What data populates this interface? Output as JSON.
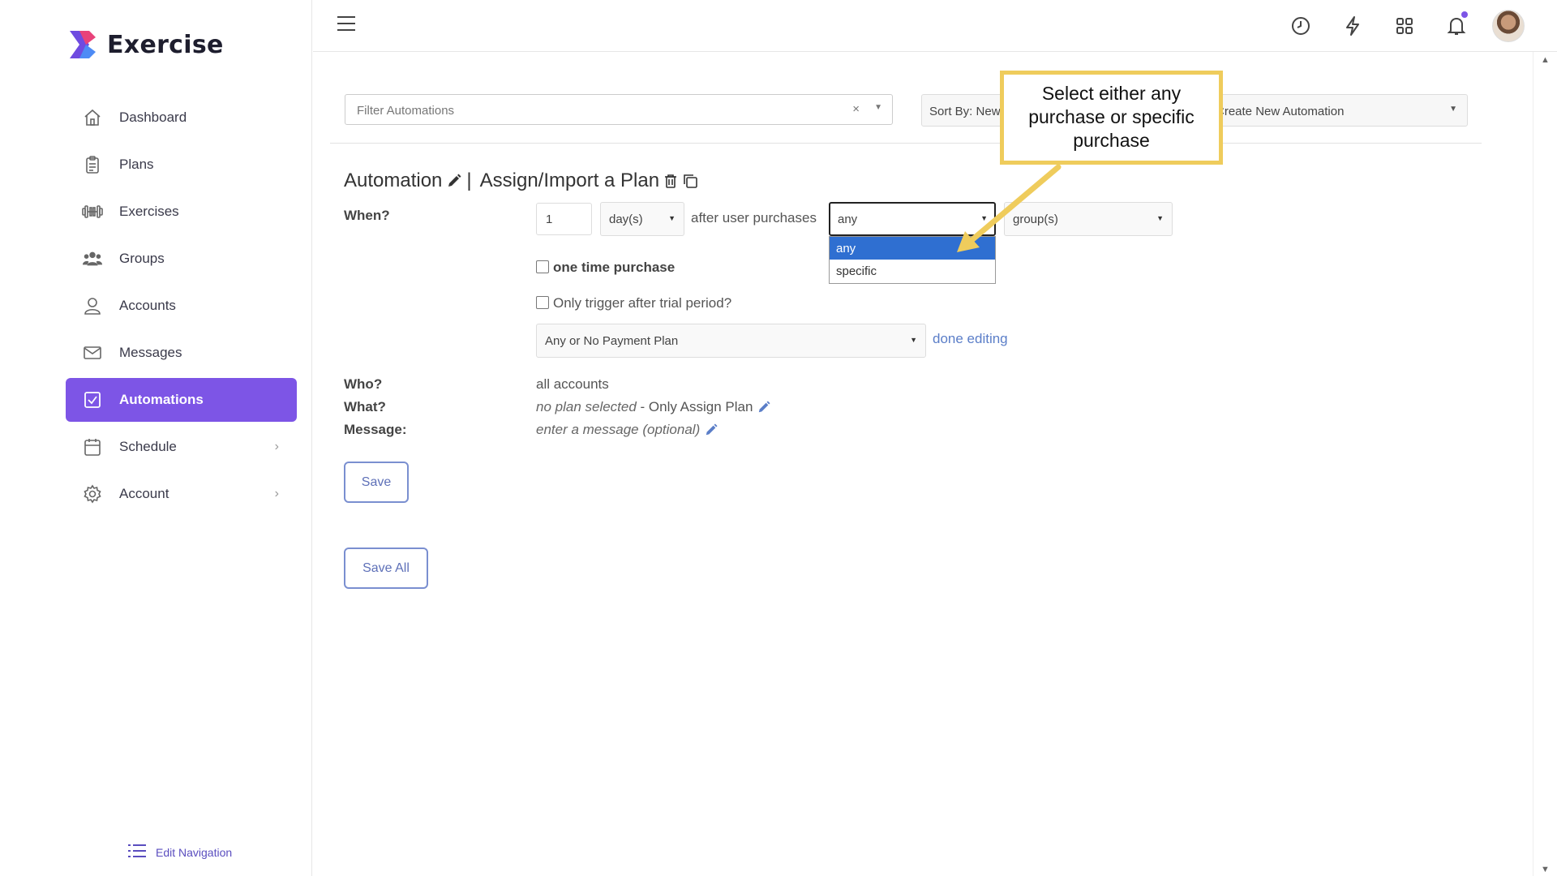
{
  "app": {
    "name": "Exercise"
  },
  "sidebar": {
    "items": [
      {
        "label": "Dashboard"
      },
      {
        "label": "Plans"
      },
      {
        "label": "Exercises"
      },
      {
        "label": "Groups"
      },
      {
        "label": "Accounts"
      },
      {
        "label": "Messages"
      },
      {
        "label": "Automations",
        "active": true
      },
      {
        "label": "Schedule",
        "has_submenu": true
      },
      {
        "label": "Account",
        "has_submenu": true
      }
    ],
    "edit_nav": "Edit Navigation"
  },
  "toolbar": {
    "filter_placeholder": "Filter Automations",
    "clear_glyph": "×",
    "sort_label": "Sort By: Newest",
    "create_label": "Create New Automation"
  },
  "callout": {
    "text": "Select either any\npurchase or specific\npurchase"
  },
  "automation": {
    "title_prefix": "Automation",
    "separator": "|",
    "title_name": "Assign/Import a Plan",
    "when_label": "When?",
    "when_number": "1",
    "unit": "day(s)",
    "after_text": "after user purchases",
    "purchase_type": "any",
    "purchase_options": [
      "any",
      "specific"
    ],
    "group_select": "group(s)",
    "one_time_label": "one time purchase",
    "trial_label": "Only trigger after trial period?",
    "payment_plan": "Any or No Payment Plan",
    "done_editing": "done editing",
    "who_label": "Who?",
    "who_value": "all accounts",
    "what_label": "What?",
    "what_italic": "no plan selected",
    "what_suffix": " - Only Assign Plan",
    "message_label": "Message:",
    "message_placeholder": "enter a message (optional)",
    "save_label": "Save",
    "save_all_label": "Save All"
  },
  "colors": {
    "accent": "#7d55e6",
    "callout_border": "#efcc5c",
    "dropdown_highlight": "#2f6fd1",
    "link": "#5b7ec8"
  }
}
